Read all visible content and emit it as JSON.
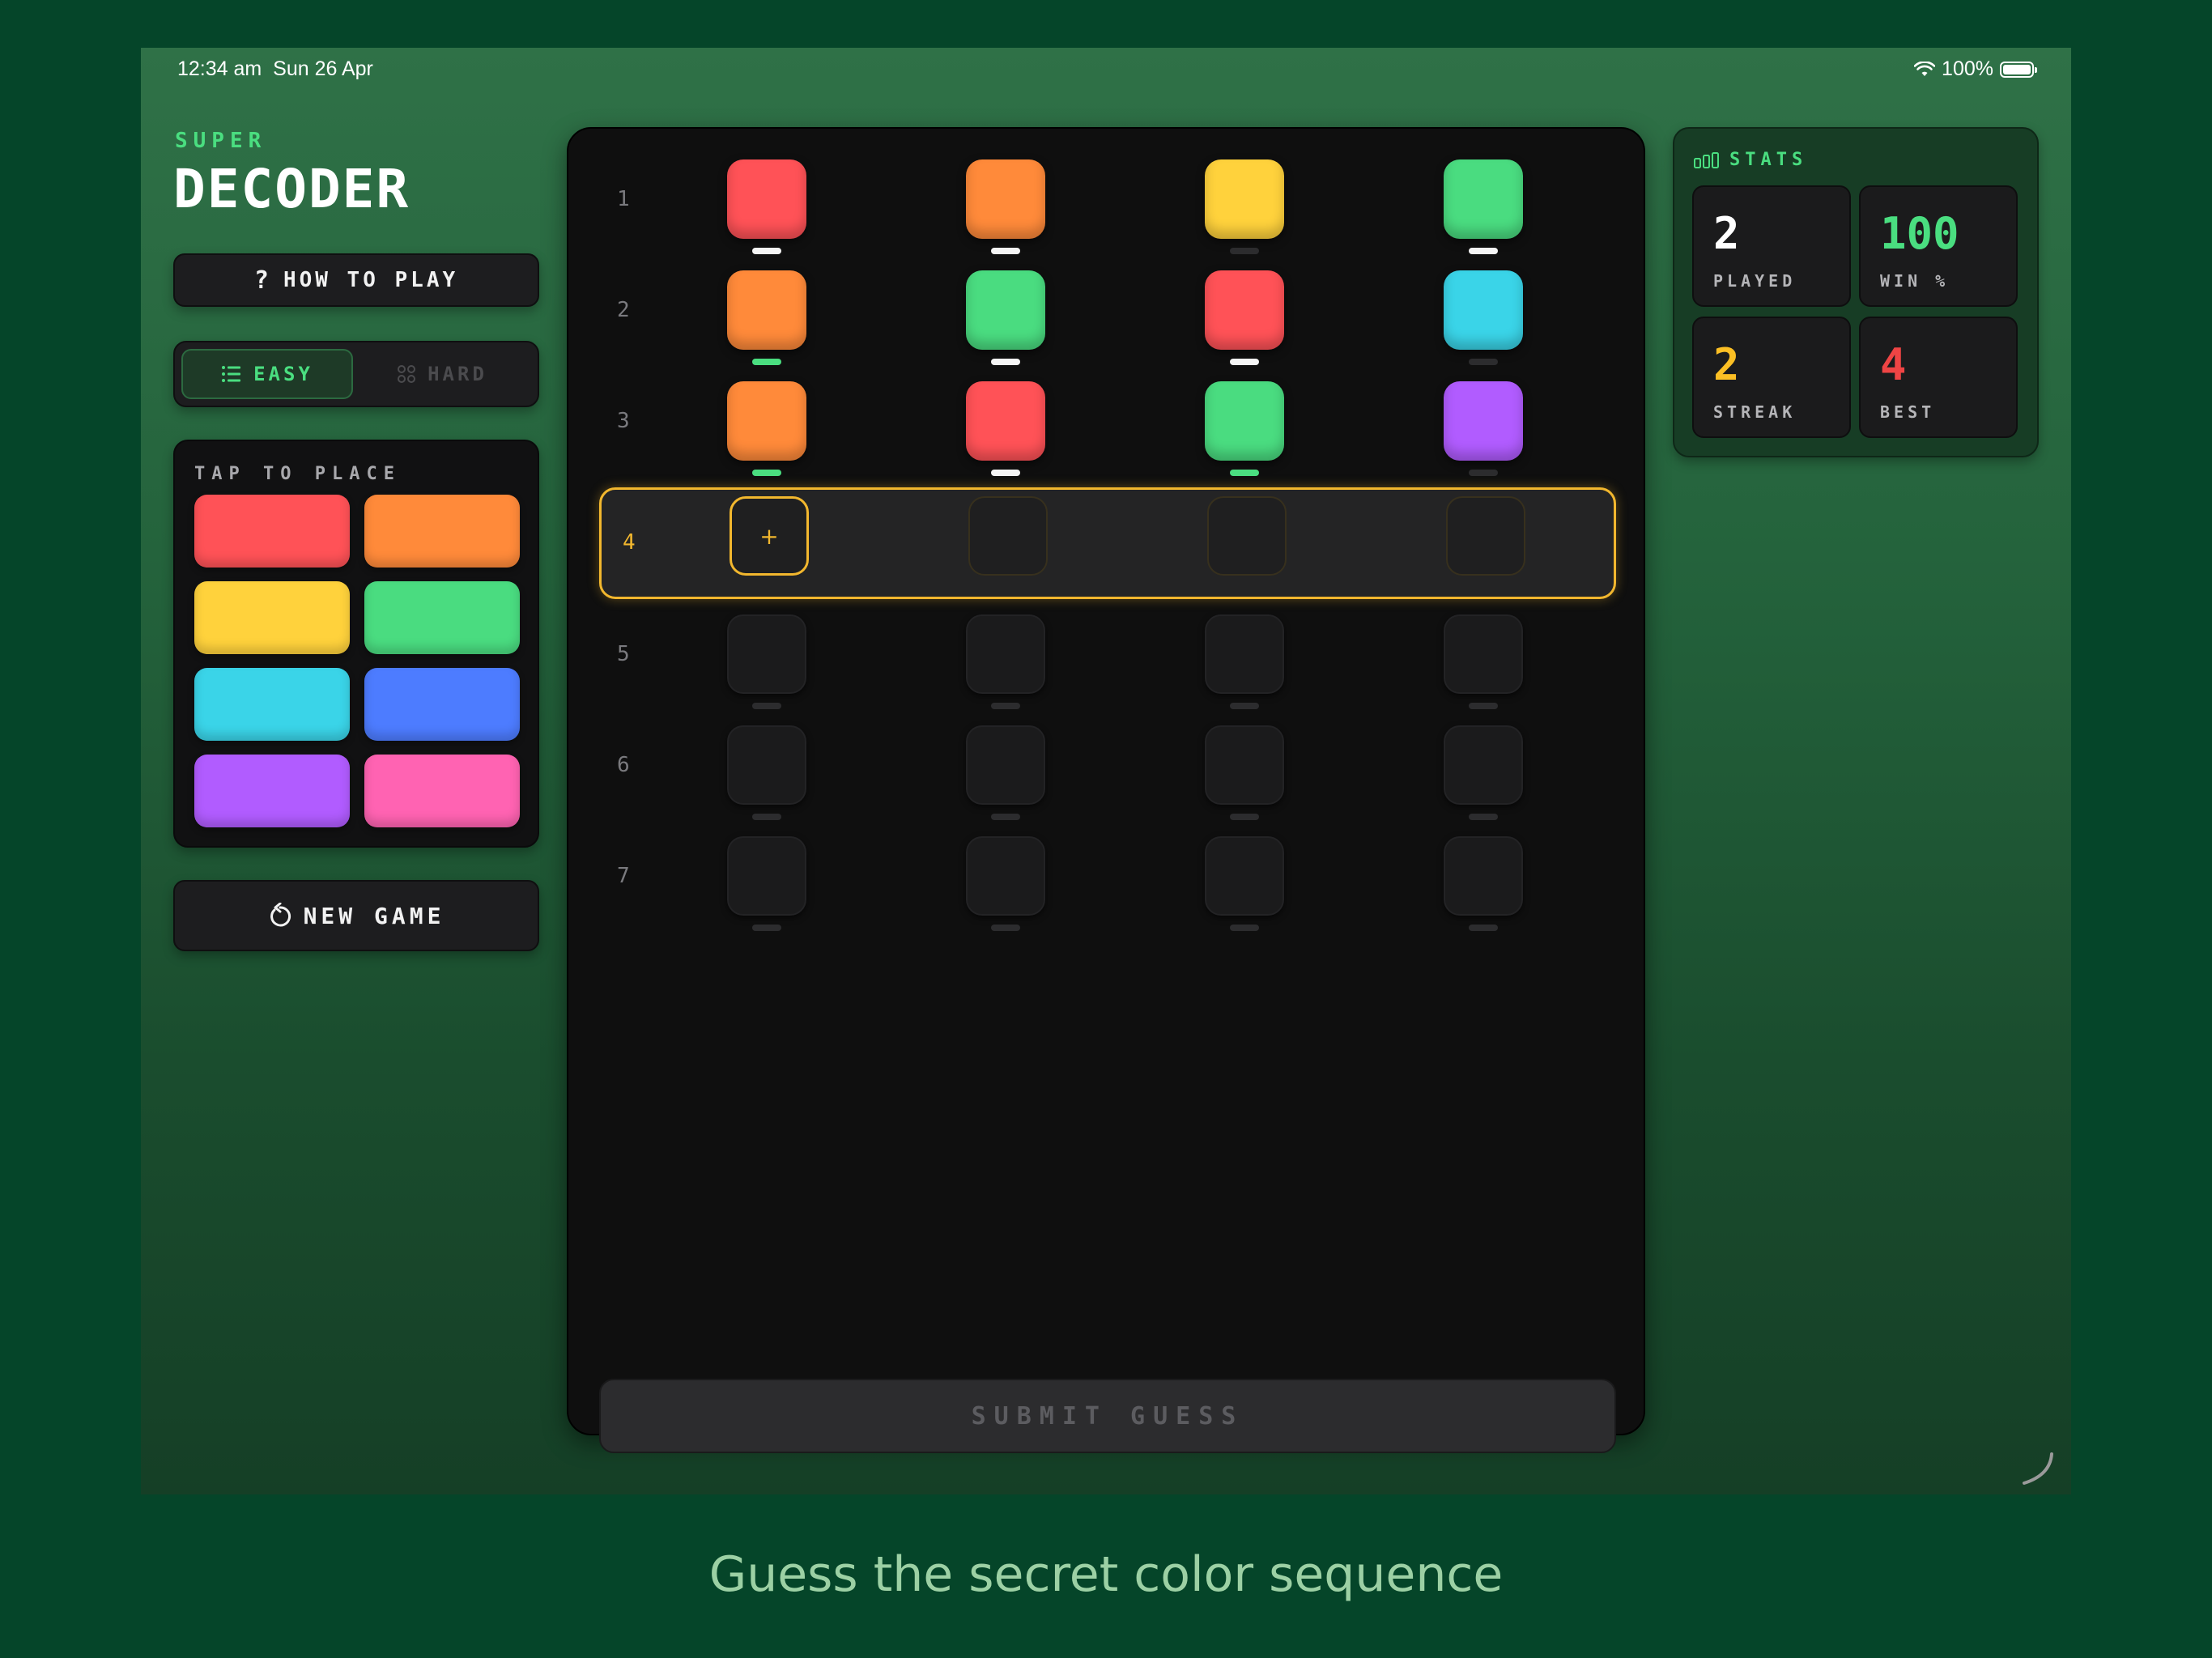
{
  "status_bar": {
    "time": "12:34 am",
    "date": "Sun 26 Apr",
    "battery": "100%"
  },
  "header": {
    "super": "SUPER",
    "title": "DECODER"
  },
  "buttons": {
    "how_to_play": "HOW TO PLAY",
    "new_game": "NEW GAME",
    "submit": "SUBMIT GUESS"
  },
  "difficulty": {
    "easy": "EASY",
    "hard": "HARD",
    "selected": "easy"
  },
  "palette": {
    "title": "TAP TO PLACE",
    "colors": [
      {
        "name": "red",
        "hex": "#ff5257"
      },
      {
        "name": "orange",
        "hex": "#ff8a3a"
      },
      {
        "name": "yellow",
        "hex": "#ffd23c"
      },
      {
        "name": "green",
        "hex": "#4adc80"
      },
      {
        "name": "cyan",
        "hex": "#3ad4e8"
      },
      {
        "name": "blue",
        "hex": "#4d7cff"
      },
      {
        "name": "purple",
        "hex": "#b15cff"
      },
      {
        "name": "pink",
        "hex": "#ff63b2"
      }
    ]
  },
  "board": {
    "row_numbers": [
      "1",
      "2",
      "3",
      "4",
      "5",
      "6",
      "7"
    ],
    "active_row": 4,
    "guesses": [
      {
        "pegs": [
          "#ff5257",
          "#ff8a3a",
          "#ffd23c",
          "#4adc80"
        ],
        "feedback": [
          "white",
          "white",
          "none",
          "white"
        ]
      },
      {
        "pegs": [
          "#ff8a3a",
          "#4adc80",
          "#ff5257",
          "#3ad4e8"
        ],
        "feedback": [
          "green",
          "white",
          "white",
          "none"
        ]
      },
      {
        "pegs": [
          "#ff8a3a",
          "#ff5257",
          "#4adc80",
          "#b15cff"
        ],
        "feedback": [
          "green",
          "white",
          "green",
          "none"
        ]
      }
    ],
    "active_placeholder": "+"
  },
  "stats": {
    "title": "STATS",
    "items": [
      {
        "value": "2",
        "label": "PLAYED",
        "color": "#ffffff"
      },
      {
        "value": "100",
        "label": "WIN %",
        "color": "#4ade80"
      },
      {
        "value": "2",
        "label": "STREAK",
        "color": "#fbbf24"
      },
      {
        "value": "4",
        "label": "BEST",
        "color": "#ef4444"
      }
    ]
  },
  "caption": "Guess the secret color sequence",
  "colors": {
    "accent": "#4ade80",
    "active": "#f2b72e",
    "feedback_white": "#f5f5f5",
    "feedback_green": "#4ade80",
    "feedback_none": "#2c2c2e"
  }
}
